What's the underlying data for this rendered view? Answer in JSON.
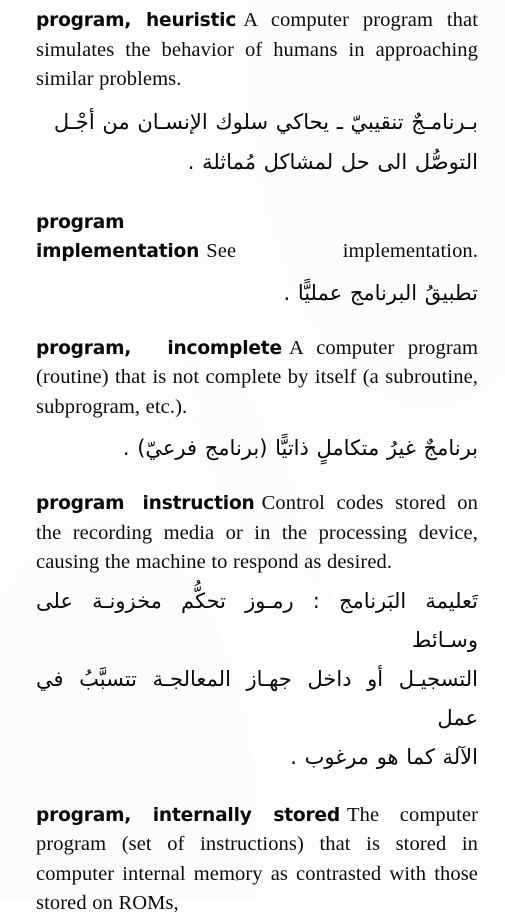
{
  "page": {
    "kind": "dictionary-page",
    "language_pair": "English-Arabic",
    "background_color": "#fefefe",
    "text_color": "#0a0a0a"
  },
  "entries": [
    {
      "headword": "program, heuristic",
      "definition": "A computer program that simulates the behavior of humans in approaching similar problems.",
      "definition_lines": [
        "A computer prog-",
        "ram that simulates the behavior of humans",
        "in approaching similar problems."
      ],
      "arabic_lines": [
        "بـرنامـجٌ تنقيبيّ ـ يحاكي سلوك الإنسـان من أجْـل",
        "التوصُّل الى حل لمشاكل مُماثلة ."
      ]
    },
    {
      "headword": "program implementation",
      "definition": "See implementation.",
      "definition_lines": [
        "See",
        "implementation."
      ],
      "arabic_lines": [
        "تطبيقُ البرنامج عمليًّا ."
      ]
    },
    {
      "headword": "program, incomplete",
      "definition": "A computer program (routine) that is not complete by itself (a subroutine, subprogram, etc.).",
      "definition_lines": [
        "A computer",
        "program (routine) that is not complete by",
        "itself (a subroutine, subprogram, etc.)."
      ],
      "arabic_lines": [
        "برنامجٌ غيرُ متكاملٍ ذاتيًّا (برنامج فرعيّ) ."
      ]
    },
    {
      "headword": "program instruction",
      "definition": "Control codes stored on the recording media or in the processing device, causing the machine to respond as desired.",
      "definition_lines": [
        "Control codes",
        "stored on the recording media or in the",
        "processing device, causing the machine to",
        "respond as desired."
      ],
      "arabic_lines": [
        "تَعليمة البَرنامج : رمـوز تحكُّم مخزونـة على وسـائط",
        "التسجيـل أو داخل جهـاز المعالجـة تتسبَّبُ في عمل",
        "الآلة كما هو مرغوب ."
      ]
    },
    {
      "headword": "program, internally stored",
      "definition": "The computer program (set of instructions) that is stored in computer internal memory as contrasted with those stored on ROMs,",
      "definition_lines": [
        "The com-",
        "puter program (set of instructions) that is",
        "stored in computer internal memory as",
        "contrasted with those stored on ROMs,"
      ],
      "arabic_lines": []
    }
  ]
}
